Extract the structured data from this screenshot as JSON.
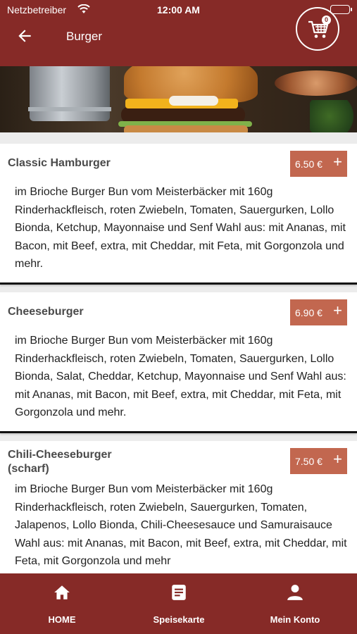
{
  "status_bar": {
    "carrier": "Netzbetreiber",
    "time": "12:00 AM",
    "icons": [
      "wifi-icon",
      "battery-icon"
    ]
  },
  "nav": {
    "title": "Burger",
    "back_icon": "arrow-left-icon",
    "cart_icon": "shopping-cart-icon",
    "cart_count": "0"
  },
  "menu": {
    "items": [
      {
        "name": "Classic Hamburger",
        "price": "6.50 €",
        "description": "im Brioche Burger Bun vom Meisterbäcker mit 160g Rinderhackfleisch, roten Zwiebeln, Tomaten, Sauergurken, Lollo Bionda, Ketchup, Mayonnaise und Senf Wahl aus: mit Ananas, mit Bacon, mit Beef, extra, mit Cheddar, mit Feta, mit Gorgonzola und mehr."
      },
      {
        "name": "Cheeseburger",
        "price": "6.90 €",
        "description": "im Brioche Burger Bun vom Meisterbäcker mit 160g Rinderhackfleisch, roten Zwiebeln, Tomaten, Sauergurken, Lollo Bionda, Salat, Cheddar, Ketchup, Mayonnaise und Senf Wahl aus: mit Ananas, mit Bacon, mit Beef, extra, mit Cheddar, mit Feta, mit Gorgonzola und mehr."
      },
      {
        "name": "Chili-Cheeseburger (scharf)",
        "price": "7.50 €",
        "description": "im Brioche Burger Bun vom Meisterbäcker mit 160g Rinderhackfleisch, roten Zwiebeln, Sauergurken, Tomaten, Jalapenos, Lollo Bionda, Chili-Cheesesauce und Samuraisauce Wahl aus: mit Ananas, mit Bacon, mit Beef, extra, mit Cheddar, mit Feta, mit Gorgonzola und mehr"
      }
    ],
    "add_icon": "plus-icon"
  },
  "tab_bar": {
    "tabs": [
      {
        "label": "HOME",
        "icon": "home-icon"
      },
      {
        "label": "Speisekarte",
        "icon": "menu-card-icon"
      },
      {
        "label": "Mein Konto",
        "icon": "user-icon"
      }
    ]
  },
  "colors": {
    "brand": "#862a27",
    "price_button": "#c2674f",
    "background": "#ececec",
    "text": "#222222"
  }
}
